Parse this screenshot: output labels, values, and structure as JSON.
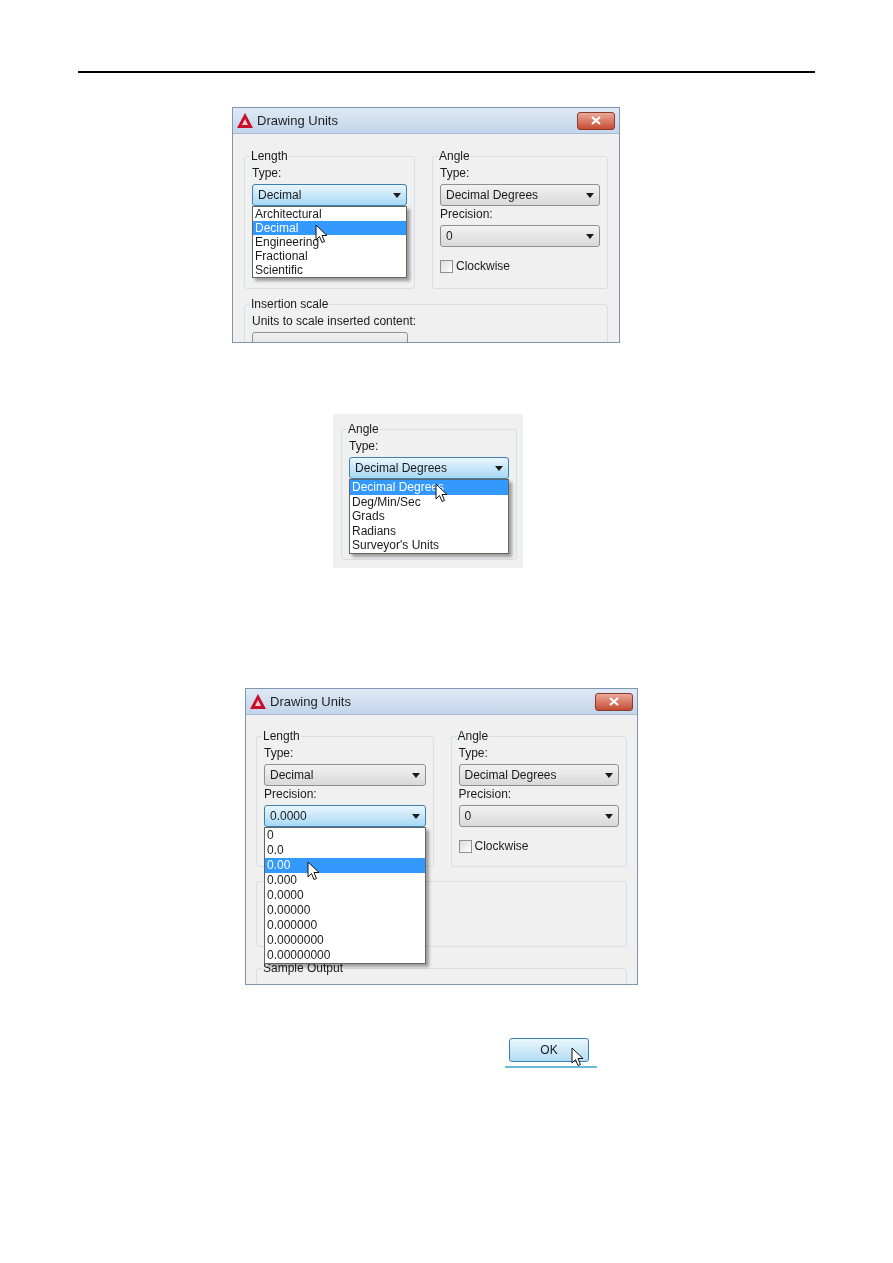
{
  "figure_1": {
    "title": "Drawing Units",
    "length": {
      "label": "Length",
      "type_label": "Type:",
      "type_value": "Decimal",
      "type_focused": true,
      "options": [
        {
          "label": "Architectural",
          "selected": false
        },
        {
          "label": "Decimal",
          "selected": true
        },
        {
          "label": "Engineering",
          "selected": false
        },
        {
          "label": "Fractional",
          "selected": false
        },
        {
          "label": "Scientific",
          "selected": false
        }
      ]
    },
    "angle": {
      "label": "Angle",
      "type_label": "Type:",
      "type_value": "Decimal Degrees",
      "type_focused": false,
      "precision_label": "Precision:",
      "precision_value": "0",
      "precision_focused": false,
      "clockwise": {
        "label": "Clockwise",
        "checked": false
      }
    },
    "insertion_scale": {
      "label": "Insertion scale",
      "units_label": "Units to scale inserted content:"
    }
  },
  "figure_2": {
    "angle": {
      "label": "Angle",
      "type_label": "Type:",
      "type_value": "Decimal Degrees",
      "type_focused": true,
      "options": [
        {
          "label": "Decimal Degrees",
          "selected": true
        },
        {
          "label": "Deg/Min/Sec",
          "selected": false
        },
        {
          "label": "Grads",
          "selected": false
        },
        {
          "label": "Radians",
          "selected": false
        },
        {
          "label": "Surveyor's Units",
          "selected": false
        }
      ]
    }
  },
  "figure_3": {
    "title": "Drawing Units",
    "length": {
      "label": "Length",
      "type_label": "Type:",
      "type_value": "Decimal",
      "type_focused": false,
      "precision_label": "Precision:",
      "precision_value": "0.0000",
      "precision_focused": true,
      "options": [
        {
          "label": "0",
          "selected": false
        },
        {
          "label": "0.0",
          "selected": false
        },
        {
          "label": "0.00",
          "selected": true
        },
        {
          "label": "0.000",
          "selected": false
        },
        {
          "label": "0.0000",
          "selected": false
        },
        {
          "label": "0.00000",
          "selected": false
        },
        {
          "label": "0.000000",
          "selected": false
        },
        {
          "label": "0.0000000",
          "selected": false
        },
        {
          "label": "0.00000000",
          "selected": false
        }
      ]
    },
    "angle": {
      "label": "Angle",
      "type_label": "Type:",
      "type_value": "Decimal Degrees",
      "type_focused": false,
      "precision_label": "Precision:",
      "precision_value": "0",
      "precision_focused": false,
      "clockwise": {
        "label": "Clockwise",
        "checked": false
      }
    },
    "sample_output": {
      "label": "Sample Output"
    }
  },
  "ok_button": {
    "label": "OK"
  }
}
